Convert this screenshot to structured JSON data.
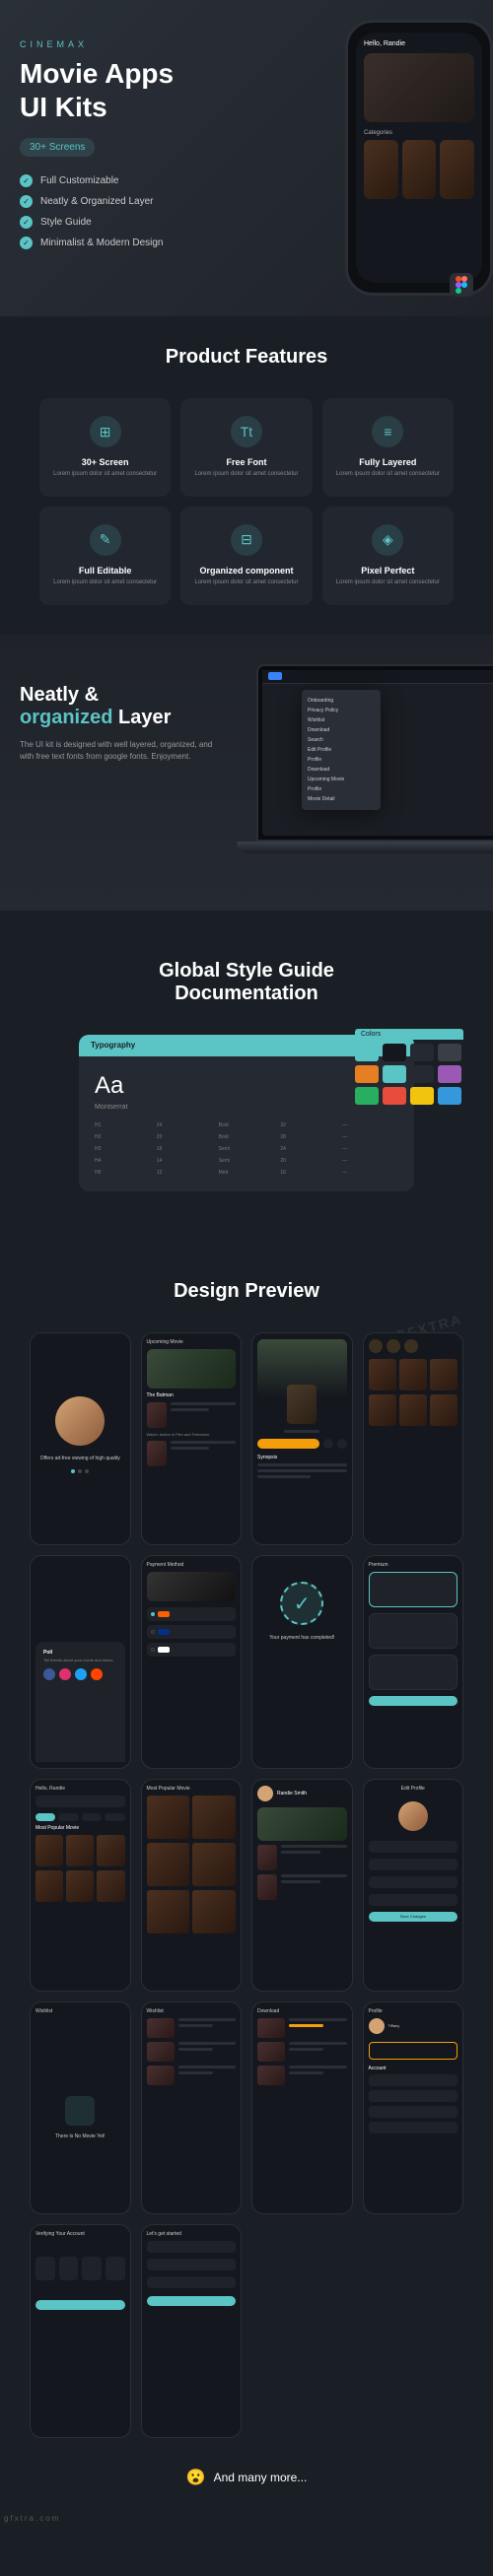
{
  "hero": {
    "brand": "CINEMAX",
    "title": "Movie Apps\nUI Kits",
    "badge": "30+ Screens",
    "features": [
      "Full Customizable",
      "Neatly & Organized Layer",
      "Style Guide",
      "Minimalist & Modern Design"
    ]
  },
  "phone_demo": {
    "greeting": "Hello, Randie",
    "category_label": "Categories"
  },
  "product_features": {
    "heading": "Product Features",
    "items": [
      {
        "icon": "⊞",
        "title": "30+ Screen",
        "desc": "Lorem ipsum dolor sit amet consectetur"
      },
      {
        "icon": "Tt",
        "title": "Free Font",
        "desc": "Lorem ipsum dolor sit amet consectetur"
      },
      {
        "icon": "≡",
        "title": "Fully Layered",
        "desc": "Lorem ipsum dolor sit amet consectetur"
      },
      {
        "icon": "✎",
        "title": "Full Editable",
        "desc": "Lorem ipsum dolor sit amet consectetur"
      },
      {
        "icon": "⊟",
        "title": "Organized component",
        "desc": "Lorem ipsum dolor sit amet consectetur"
      },
      {
        "icon": "◈",
        "title": "Pixel Perfect",
        "desc": "Lorem ipsum dolor sit amet consectetur"
      }
    ]
  },
  "layer": {
    "title_pre": "Neatly &",
    "title_accent": "organized",
    "title_post": " Layer",
    "desc": "The UI kit is designed with well layered, organized, and with free text fonts from google fonts. Enjoyment.",
    "menu_items": [
      "Onboarding",
      "Privacy Policy",
      "Wishlist",
      "Download",
      "Search",
      "Edit Profile",
      "Profile",
      "Download",
      "Upcoming Movie",
      "Profile",
      "Movie Detail"
    ]
  },
  "style_guide": {
    "heading": "Global Style Guide\nDocumentation",
    "typography_label": "Typography",
    "sample": "Aa",
    "font_name": "Montserrat",
    "colors_label": "Colors",
    "swatches": [
      [
        "#5bc4c4",
        "#14171d",
        "#252a32",
        "#3a3f47"
      ],
      [
        "#e67e22",
        "#5bc4c4",
        "#252a32",
        "#9b59b6"
      ],
      [
        "#27ae60",
        "#e74c3c",
        "#f1c40f",
        "#3498db"
      ]
    ]
  },
  "preview": {
    "heading": "Design Preview",
    "onboard_text": "Offers ad-free viewing of high quality",
    "upcoming": "Upcoming Movie",
    "batman": "The Batman",
    "synopsis": "Synopsis",
    "watch_now": "Watch: Action in Film and Television",
    "poll": "Poll",
    "tell_friends": "Tell friends about your movie and series",
    "payment": "Payment Method",
    "success": "Your payment has completed!",
    "premium": "Premium",
    "most_popular": "Most Popular Movie",
    "profile_name": "Randie Smith",
    "edit_profile": "Edit Profile",
    "wishlist": "Wishlist",
    "no_movie": "There Is No Movie Yet!",
    "download": "Download",
    "profile": "Profile",
    "account": "Account",
    "save_changes": "Save Changes",
    "verifying": "Verifying Your Account",
    "lets_get_started": "Let's get started",
    "many_more": "And many more..."
  },
  "watermarks": {
    "gfxtra": "GFXTRA",
    "footer": "gfxtra.com"
  }
}
